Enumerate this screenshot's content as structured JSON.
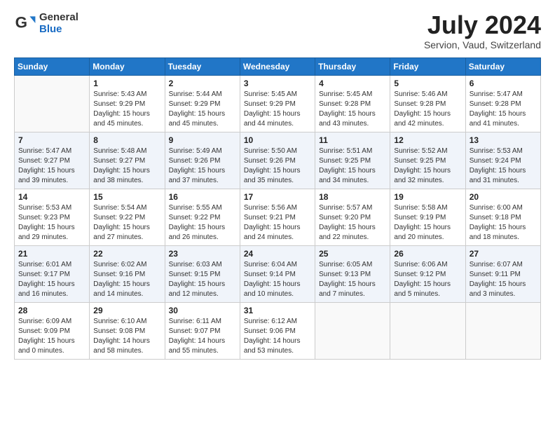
{
  "header": {
    "logo_general": "General",
    "logo_blue": "Blue",
    "month": "July 2024",
    "location": "Servion, Vaud, Switzerland"
  },
  "weekdays": [
    "Sunday",
    "Monday",
    "Tuesday",
    "Wednesday",
    "Thursday",
    "Friday",
    "Saturday"
  ],
  "weeks": [
    [
      {
        "day": "",
        "info": ""
      },
      {
        "day": "1",
        "info": "Sunrise: 5:43 AM\nSunset: 9:29 PM\nDaylight: 15 hours\nand 45 minutes."
      },
      {
        "day": "2",
        "info": "Sunrise: 5:44 AM\nSunset: 9:29 PM\nDaylight: 15 hours\nand 45 minutes."
      },
      {
        "day": "3",
        "info": "Sunrise: 5:45 AM\nSunset: 9:29 PM\nDaylight: 15 hours\nand 44 minutes."
      },
      {
        "day": "4",
        "info": "Sunrise: 5:45 AM\nSunset: 9:28 PM\nDaylight: 15 hours\nand 43 minutes."
      },
      {
        "day": "5",
        "info": "Sunrise: 5:46 AM\nSunset: 9:28 PM\nDaylight: 15 hours\nand 42 minutes."
      },
      {
        "day": "6",
        "info": "Sunrise: 5:47 AM\nSunset: 9:28 PM\nDaylight: 15 hours\nand 41 minutes."
      }
    ],
    [
      {
        "day": "7",
        "info": "Sunrise: 5:47 AM\nSunset: 9:27 PM\nDaylight: 15 hours\nand 39 minutes."
      },
      {
        "day": "8",
        "info": "Sunrise: 5:48 AM\nSunset: 9:27 PM\nDaylight: 15 hours\nand 38 minutes."
      },
      {
        "day": "9",
        "info": "Sunrise: 5:49 AM\nSunset: 9:26 PM\nDaylight: 15 hours\nand 37 minutes."
      },
      {
        "day": "10",
        "info": "Sunrise: 5:50 AM\nSunset: 9:26 PM\nDaylight: 15 hours\nand 35 minutes."
      },
      {
        "day": "11",
        "info": "Sunrise: 5:51 AM\nSunset: 9:25 PM\nDaylight: 15 hours\nand 34 minutes."
      },
      {
        "day": "12",
        "info": "Sunrise: 5:52 AM\nSunset: 9:25 PM\nDaylight: 15 hours\nand 32 minutes."
      },
      {
        "day": "13",
        "info": "Sunrise: 5:53 AM\nSunset: 9:24 PM\nDaylight: 15 hours\nand 31 minutes."
      }
    ],
    [
      {
        "day": "14",
        "info": "Sunrise: 5:53 AM\nSunset: 9:23 PM\nDaylight: 15 hours\nand 29 minutes."
      },
      {
        "day": "15",
        "info": "Sunrise: 5:54 AM\nSunset: 9:22 PM\nDaylight: 15 hours\nand 27 minutes."
      },
      {
        "day": "16",
        "info": "Sunrise: 5:55 AM\nSunset: 9:22 PM\nDaylight: 15 hours\nand 26 minutes."
      },
      {
        "day": "17",
        "info": "Sunrise: 5:56 AM\nSunset: 9:21 PM\nDaylight: 15 hours\nand 24 minutes."
      },
      {
        "day": "18",
        "info": "Sunrise: 5:57 AM\nSunset: 9:20 PM\nDaylight: 15 hours\nand 22 minutes."
      },
      {
        "day": "19",
        "info": "Sunrise: 5:58 AM\nSunset: 9:19 PM\nDaylight: 15 hours\nand 20 minutes."
      },
      {
        "day": "20",
        "info": "Sunrise: 6:00 AM\nSunset: 9:18 PM\nDaylight: 15 hours\nand 18 minutes."
      }
    ],
    [
      {
        "day": "21",
        "info": "Sunrise: 6:01 AM\nSunset: 9:17 PM\nDaylight: 15 hours\nand 16 minutes."
      },
      {
        "day": "22",
        "info": "Sunrise: 6:02 AM\nSunset: 9:16 PM\nDaylight: 15 hours\nand 14 minutes."
      },
      {
        "day": "23",
        "info": "Sunrise: 6:03 AM\nSunset: 9:15 PM\nDaylight: 15 hours\nand 12 minutes."
      },
      {
        "day": "24",
        "info": "Sunrise: 6:04 AM\nSunset: 9:14 PM\nDaylight: 15 hours\nand 10 minutes."
      },
      {
        "day": "25",
        "info": "Sunrise: 6:05 AM\nSunset: 9:13 PM\nDaylight: 15 hours\nand 7 minutes."
      },
      {
        "day": "26",
        "info": "Sunrise: 6:06 AM\nSunset: 9:12 PM\nDaylight: 15 hours\nand 5 minutes."
      },
      {
        "day": "27",
        "info": "Sunrise: 6:07 AM\nSunset: 9:11 PM\nDaylight: 15 hours\nand 3 minutes."
      }
    ],
    [
      {
        "day": "28",
        "info": "Sunrise: 6:09 AM\nSunset: 9:09 PM\nDaylight: 15 hours\nand 0 minutes."
      },
      {
        "day": "29",
        "info": "Sunrise: 6:10 AM\nSunset: 9:08 PM\nDaylight: 14 hours\nand 58 minutes."
      },
      {
        "day": "30",
        "info": "Sunrise: 6:11 AM\nSunset: 9:07 PM\nDaylight: 14 hours\nand 55 minutes."
      },
      {
        "day": "31",
        "info": "Sunrise: 6:12 AM\nSunset: 9:06 PM\nDaylight: 14 hours\nand 53 minutes."
      },
      {
        "day": "",
        "info": ""
      },
      {
        "day": "",
        "info": ""
      },
      {
        "day": "",
        "info": ""
      }
    ]
  ]
}
